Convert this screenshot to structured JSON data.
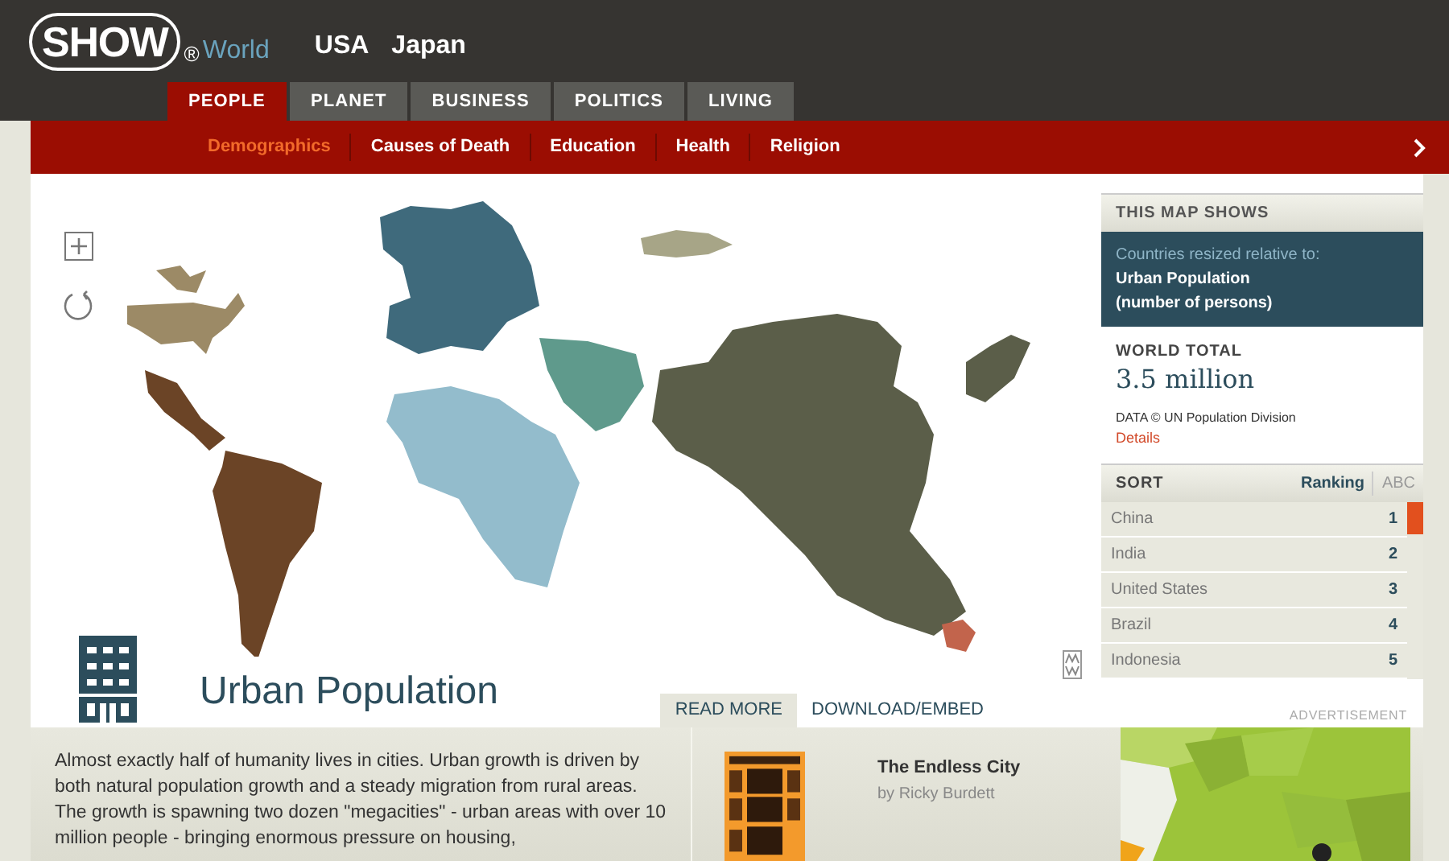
{
  "logo": {
    "brand": "SHOW",
    "mark": "®",
    "sub": "World"
  },
  "country_links": [
    "USA",
    "Japan"
  ],
  "tabs": [
    {
      "label": "PEOPLE",
      "selected": true
    },
    {
      "label": "PLANET",
      "selected": false
    },
    {
      "label": "BUSINESS",
      "selected": false
    },
    {
      "label": "POLITICS",
      "selected": false
    },
    {
      "label": "LIVING",
      "selected": false
    }
  ],
  "subnav": [
    {
      "label": "Demographics",
      "selected": true
    },
    {
      "label": "Causes of Death",
      "selected": false
    },
    {
      "label": "Education",
      "selected": false
    },
    {
      "label": "Health",
      "selected": false
    },
    {
      "label": "Religion",
      "selected": false
    }
  ],
  "map": {
    "title": "Urban Population"
  },
  "info_tabs": [
    {
      "label": "READ MORE",
      "selected": true
    },
    {
      "label": "DOWNLOAD/EMBED",
      "selected": false
    }
  ],
  "sidebar": {
    "header": "THIS MAP SHOWS",
    "resized_label": "Countries resized relative to:",
    "measure": "Urban Population",
    "unit": "(number of persons)",
    "total_label": "WORLD TOTAL",
    "total_value": "3.5 million",
    "source": "DATA © UN Population Division",
    "details_link": "Details",
    "sort_label": "SORT",
    "sort_options": [
      {
        "label": "Ranking",
        "selected": true
      },
      {
        "label": "ABC",
        "selected": false
      }
    ],
    "rankings": [
      {
        "name": "China",
        "rank": "1"
      },
      {
        "name": "India",
        "rank": "2"
      },
      {
        "name": "United States",
        "rank": "3"
      },
      {
        "name": "Brazil",
        "rank": "4"
      },
      {
        "name": "Indonesia",
        "rank": "5"
      }
    ]
  },
  "advertisement_label": "ADVERTISEMENT",
  "description": "Almost exactly half of humanity lives in cities. Urban growth is driven by both natural population growth and a steady migration from rural areas. The growth is spawning two dozen \"megacities\" - urban areas with over 10 million people - bringing enormous pressure on housing,",
  "book": {
    "title": "The Endless City",
    "author": "by Ricky Burdett"
  }
}
